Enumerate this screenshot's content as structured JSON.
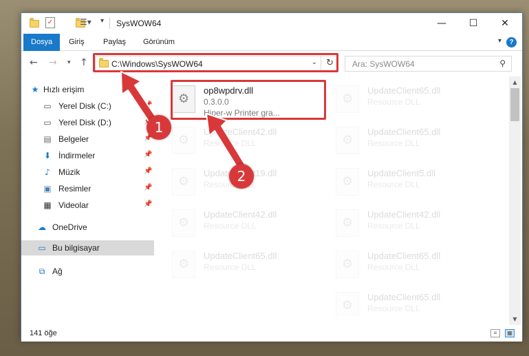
{
  "window": {
    "title": "SysWOW64"
  },
  "title_buttons": {
    "minimize": "—",
    "maximize": "☐",
    "close": "✕"
  },
  "ribbon": {
    "tabs": [
      {
        "label": "Dosya",
        "active": true
      },
      {
        "label": "Giriş",
        "active": false
      },
      {
        "label": "Paylaş",
        "active": false
      },
      {
        "label": "Görünüm",
        "active": false
      }
    ],
    "help": "?"
  },
  "nav": {
    "address": "C:\\Windows\\SysWOW64",
    "search_placeholder": "Ara: SysWOW64"
  },
  "sidebar": {
    "items": [
      {
        "label": "Hızlı erişim",
        "icon": "star-icon"
      },
      {
        "label": "Yerel Disk (C:)",
        "icon": "drive-icon"
      },
      {
        "label": "Yerel Disk (D:)",
        "icon": "drive-icon"
      },
      {
        "label": "Belgeler",
        "icon": "documents-icon"
      },
      {
        "label": "İndirmeler",
        "icon": "download-icon"
      },
      {
        "label": "Müzik",
        "icon": "music-icon"
      },
      {
        "label": "Resimler",
        "icon": "pictures-icon"
      },
      {
        "label": "Videolar",
        "icon": "videos-icon"
      },
      {
        "label": "OneDrive",
        "icon": "cloud-icon"
      },
      {
        "label": "Bu bilgisayar",
        "icon": "computer-icon"
      },
      {
        "label": "Ağ",
        "icon": "network-icon"
      }
    ]
  },
  "files": [
    {
      "name": "op8wpdrv.dll",
      "line1": "0.3.0.0",
      "line2": "Hiper-w Printer gra...",
      "faded": false
    },
    {
      "name": "UpdateClient65.dll",
      "line1": "Resource DLL",
      "line2": "",
      "faded": true
    },
    {
      "name": "UpdateClient42.dll",
      "line1": "Resource DLL",
      "line2": "",
      "faded": true
    },
    {
      "name": "UpdateClient65.dll",
      "line1": "Resource DLL",
      "line2": "",
      "faded": true
    },
    {
      "name": "UpdateClient19.dll",
      "line1": "Resource DLL",
      "line2": "",
      "faded": true
    },
    {
      "name": "UpdateClient5.dll",
      "line1": "Resource DLL",
      "line2": "",
      "faded": true
    },
    {
      "name": "UpdateClient42.dll",
      "line1": "Resource DLL",
      "line2": "",
      "faded": true
    },
    {
      "name": "UpdateClient42.dll",
      "line1": "Resource DLL",
      "line2": "",
      "faded": true
    },
    {
      "name": "UpdateClient65.dll",
      "line1": "Resource DLL",
      "line2": "",
      "faded": true
    },
    {
      "name": "UpdateClient65.dll",
      "line1": "Resource DLL",
      "line2": "",
      "faded": true
    },
    {
      "name": "UpdateClient65.dll",
      "line1": "Resource DLL",
      "line2": "",
      "faded": true
    }
  ],
  "status": {
    "count": "141 öğe"
  },
  "annotations": {
    "step1": "1",
    "step2": "2",
    "color": "#d9383a"
  },
  "colors": {
    "accent": "#1979ca",
    "selection": "#d9d9d9"
  }
}
